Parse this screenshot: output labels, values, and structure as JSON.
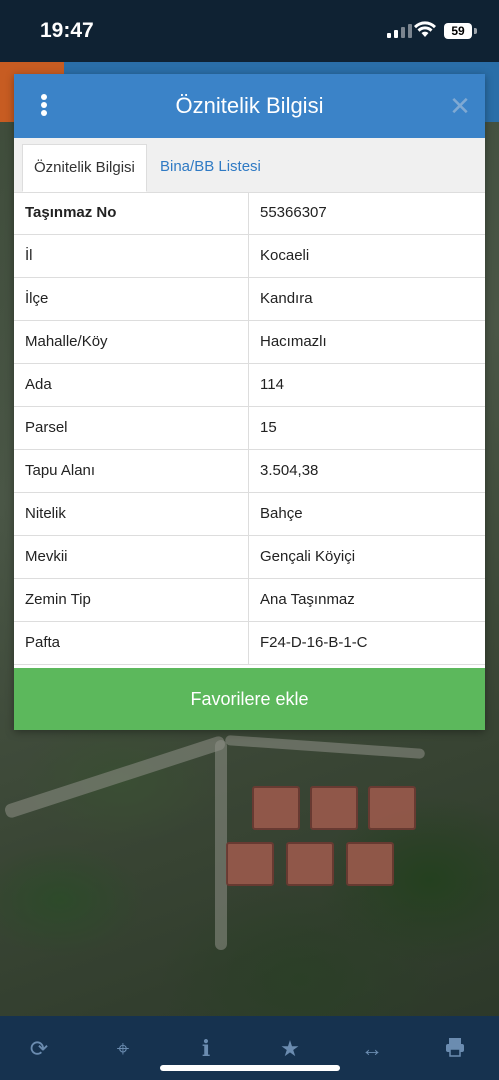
{
  "status": {
    "time": "19:47",
    "battery": "59"
  },
  "dialog": {
    "title": "Öznitelik Bilgisi",
    "tabs": [
      {
        "label": "Öznitelik Bilgisi"
      },
      {
        "label": "Bina/BB Listesi"
      }
    ],
    "rows": [
      {
        "key": "Taşınmaz No",
        "value": "55366307"
      },
      {
        "key": "İl",
        "value": "Kocaeli"
      },
      {
        "key": "İlçe",
        "value": "Kandıra"
      },
      {
        "key": "Mahalle/Köy",
        "value": "Hacımazlı"
      },
      {
        "key": "Ada",
        "value": "114"
      },
      {
        "key": "Parsel",
        "value": "15"
      },
      {
        "key": "Tapu Alanı",
        "value": "3.504,38"
      },
      {
        "key": "Nitelik",
        "value": "Bahçe"
      },
      {
        "key": "Mevkii",
        "value": "Gençali Köyiçi"
      },
      {
        "key": "Zemin Tip",
        "value": "Ana Taşınmaz"
      },
      {
        "key": "Pafta",
        "value": "F24-D-16-B-1-C"
      }
    ],
    "favorite_label": "Favorilere ekle"
  },
  "toolbar": {
    "icons": [
      "refresh-icon",
      "locate-icon",
      "info-icon",
      "star-icon",
      "measure-icon",
      "print-icon"
    ]
  },
  "colors": {
    "header": "#3b83c8",
    "favorite": "#5cb85c",
    "toolbar": "#16324f",
    "tab_link": "#2f7ac4"
  }
}
